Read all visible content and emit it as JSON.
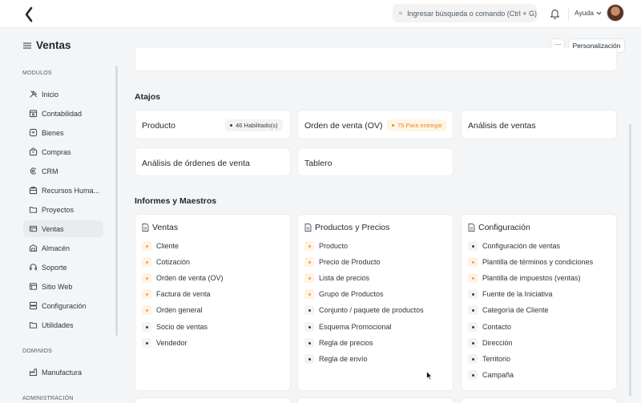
{
  "topbar": {
    "search_placeholder": "Ingresar búsqueda o comando (Ctrl + G)",
    "help_label": "Ayuda"
  },
  "page": {
    "title": "Ventas",
    "more_label": "···",
    "customize_label": "Personalización"
  },
  "sidebar": {
    "modules_label": "MODULOS",
    "items": [
      {
        "label": "Inicio",
        "icon": "tools-icon"
      },
      {
        "label": "Contabilidad",
        "icon": "accounting-icon"
      },
      {
        "label": "Bienes",
        "icon": "assets-icon"
      },
      {
        "label": "Compras",
        "icon": "buying-icon"
      },
      {
        "label": "CRM",
        "icon": "crm-icon"
      },
      {
        "label": "Recursos Huma...",
        "icon": "hr-icon"
      },
      {
        "label": "Proyectos",
        "icon": "folder-icon"
      },
      {
        "label": "Ventas",
        "icon": "sales-icon",
        "active": true
      },
      {
        "label": "Almacén",
        "icon": "stock-icon"
      },
      {
        "label": "Soporte",
        "icon": "support-icon"
      },
      {
        "label": "Sitio Web",
        "icon": "website-icon"
      },
      {
        "label": "Configuración",
        "icon": "settings-icon"
      },
      {
        "label": "Utilidades",
        "icon": "folder-icon"
      }
    ],
    "domains_label": "DOMINIOS",
    "domain_items": [
      {
        "label": "Manufactura",
        "icon": "manufacturing-icon"
      }
    ],
    "admin_label": "ADMINISTRACIÓN"
  },
  "shortcuts": {
    "title": "Atajos",
    "items": [
      {
        "label": "Producto",
        "badge": "46 Habilitado(s)",
        "badge_color": "gray"
      },
      {
        "label": "Orden de venta (OV)",
        "badge": "75 Para entregar",
        "badge_color": "orange"
      },
      {
        "label": "Análisis de ventas"
      },
      {
        "label": "Análisis de órdenes de venta"
      },
      {
        "label": "Tablero"
      }
    ]
  },
  "reports": {
    "title": "Informes y Maestros",
    "cards": [
      {
        "title": "Ventas",
        "links": [
          {
            "label": "Cliente",
            "color": "orange"
          },
          {
            "label": "Cotización",
            "color": "orange"
          },
          {
            "label": "Orden de venta (OV)",
            "color": "orange"
          },
          {
            "label": "Factura de venta",
            "color": "orange"
          },
          {
            "label": "Orden general",
            "color": "orange"
          },
          {
            "label": "Socio de ventas",
            "color": "gray"
          },
          {
            "label": "Vendedor",
            "color": "gray"
          }
        ]
      },
      {
        "title": "Productos y Precios",
        "links": [
          {
            "label": "Producto",
            "color": "orange"
          },
          {
            "label": "Precio de Producto",
            "color": "orange"
          },
          {
            "label": "Lista de precios",
            "color": "orange"
          },
          {
            "label": "Grupo de Productos",
            "color": "orange"
          },
          {
            "label": "Conjunto / paquete de productos",
            "color": "gray"
          },
          {
            "label": "Esquema Promocional",
            "color": "gray"
          },
          {
            "label": "Regla de precios",
            "color": "gray"
          },
          {
            "label": "Regla de envío",
            "color": "gray"
          }
        ]
      },
      {
        "title": "Configuración",
        "links": [
          {
            "label": "Configuración de ventas",
            "color": "gray"
          },
          {
            "label": "Plantilla de términos y condiciones",
            "color": "orange"
          },
          {
            "label": "Plantilla de impuestos (ventas)",
            "color": "orange"
          },
          {
            "label": "Fuente de la Iniciativa",
            "color": "gray"
          },
          {
            "label": "Categoría de Cliente",
            "color": "gray"
          },
          {
            "label": "Contacto",
            "color": "gray"
          },
          {
            "label": "Dirección",
            "color": "gray"
          },
          {
            "label": "Territorio",
            "color": "gray"
          },
          {
            "label": "Campaña",
            "color": "gray"
          }
        ]
      }
    ]
  }
}
